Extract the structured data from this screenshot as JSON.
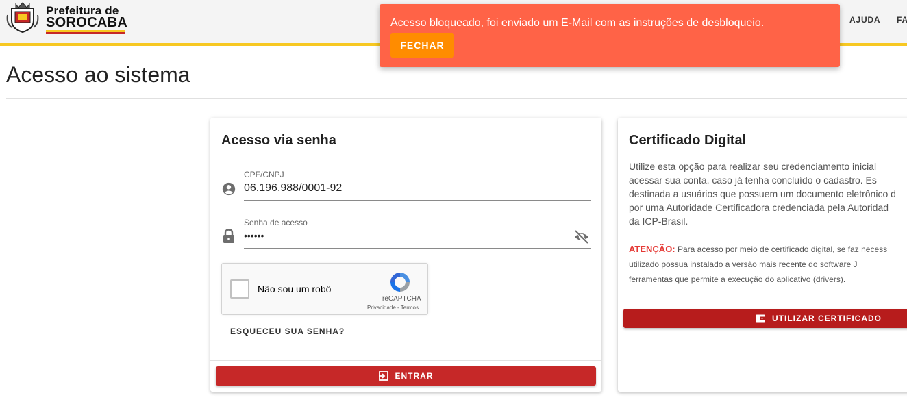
{
  "header": {
    "logo": {
      "line1": "Prefeitura de",
      "line2": "SOROCABA"
    },
    "nav": [
      "AJUDA",
      "FA"
    ]
  },
  "page": {
    "title": "Acesso ao sistema"
  },
  "login_card": {
    "title": "Acesso via senha",
    "cpf_field": {
      "label": "CPF/CNPJ",
      "value": "06.196.988/0001-92"
    },
    "password_field": {
      "label": "Senha de acesso",
      "value": "••••••"
    },
    "recaptcha": {
      "label": "Não sou um robô",
      "brand": "reCAPTCHA",
      "links": "Privacidade - Termos"
    },
    "forgot_label": "ESQUECEU SUA SENHA?",
    "submit_label": "ENTRAR"
  },
  "cert_card": {
    "title": "Certificado Digital",
    "description_lines": [
      "Utilize esta opção para realizar seu credenciamento inicial",
      "acessar sua conta, caso já tenha concluído o cadastro. Es",
      "destinada a usuários que possuem um documento eletrônico d",
      "por uma Autoridade Certificadora credenciada pela Autoridad",
      "da ICP-Brasil."
    ],
    "warning_label": "ATENÇÃO:",
    "warning_lines": [
      "Para acesso por meio de certificado digital, se faz necess",
      "utilizado possua instalado a versão mais recente do software J",
      "ferramentas que permite a execução do aplicativo (drivers)."
    ],
    "button_label": "UTILIZAR CERTIFICADO"
  },
  "toast": {
    "message": "Acesso bloqueado, foi enviado um E-Mail com as instruções de desbloqueio.",
    "close_label": "FECHAR",
    "color": "#ff6347",
    "button_color": "#ff8c00"
  },
  "colors": {
    "header_accent": "#f7c822",
    "primary": "#c62828",
    "warning": "#e53935"
  }
}
